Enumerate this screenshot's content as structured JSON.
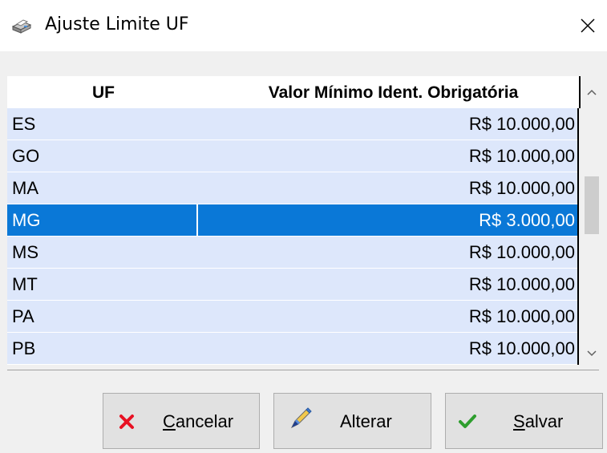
{
  "window": {
    "title": "Ajuste Limite UF",
    "icon": "printer-icon",
    "close_icon": "close-icon"
  },
  "grid": {
    "columns": [
      "UF",
      "Valor Mínimo Ident. Obrigatória"
    ],
    "rows": [
      {
        "uf": "ES",
        "valor": "R$ 10.000,00",
        "selected": false
      },
      {
        "uf": "GO",
        "valor": "R$ 10.000,00",
        "selected": false
      },
      {
        "uf": "MA",
        "valor": "R$ 10.000,00",
        "selected": false
      },
      {
        "uf": "MG",
        "valor": "R$ 3.000,00",
        "selected": true
      },
      {
        "uf": "MS",
        "valor": "R$ 10.000,00",
        "selected": false
      },
      {
        "uf": "MT",
        "valor": "R$ 10.000,00",
        "selected": false
      },
      {
        "uf": "PA",
        "valor": "R$ 10.000,00",
        "selected": false
      },
      {
        "uf": "PB",
        "valor": "R$ 10.000,00",
        "selected": false
      }
    ]
  },
  "buttons": {
    "cancel": {
      "label": "Cancelar",
      "icon": "x-icon"
    },
    "alter": {
      "label": "Alterar",
      "icon": "pencil-icon"
    },
    "save": {
      "label": "Salvar",
      "icon": "checkmark-icon"
    }
  },
  "colors": {
    "row_bg": "#dde7fb",
    "selected_bg": "#0a78d7",
    "cancel_icon": "#e81123",
    "save_icon": "#2e9e2e"
  }
}
